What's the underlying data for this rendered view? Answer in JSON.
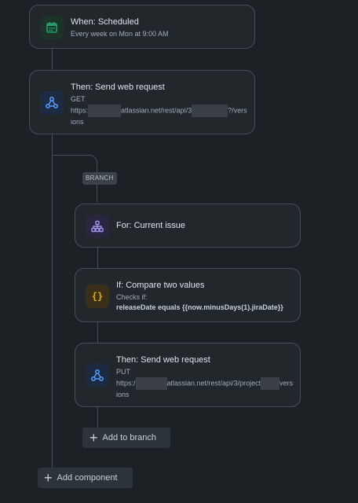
{
  "trigger": {
    "title": "When: Scheduled",
    "detail": "Every week on Mon at 9:00 AM",
    "icon": "calendar-icon",
    "accent": "#22a06b"
  },
  "action1": {
    "title": "Then: Send web request",
    "method": "GET",
    "url_part1": "https:",
    "url_part2": "atlassian.net/rest/api/3",
    "url_part3": "?/vers",
    "url_part4": "ions",
    "icon": "webhook-icon"
  },
  "branch": {
    "tag": "BRANCH",
    "for": {
      "title": "For: Current issue",
      "icon": "hierarchy-icon"
    },
    "condition": {
      "title": "If: Compare two values",
      "checks_label": "Checks if:",
      "expression": "releaseDate equals {{now.minusDays(1).jiraDate}}",
      "icon": "braces-icon",
      "accent": "#e2b203"
    },
    "action": {
      "title": "Then: Send web request",
      "method": "PUT",
      "url_part1": "https:/",
      "url_part2": "atlassian.net/rest/api/3/project",
      "url_part3": "vers",
      "url_part4": "ions",
      "icon": "webhook-icon"
    },
    "add_label": "Add to branch"
  },
  "add_component_label": "Add component"
}
